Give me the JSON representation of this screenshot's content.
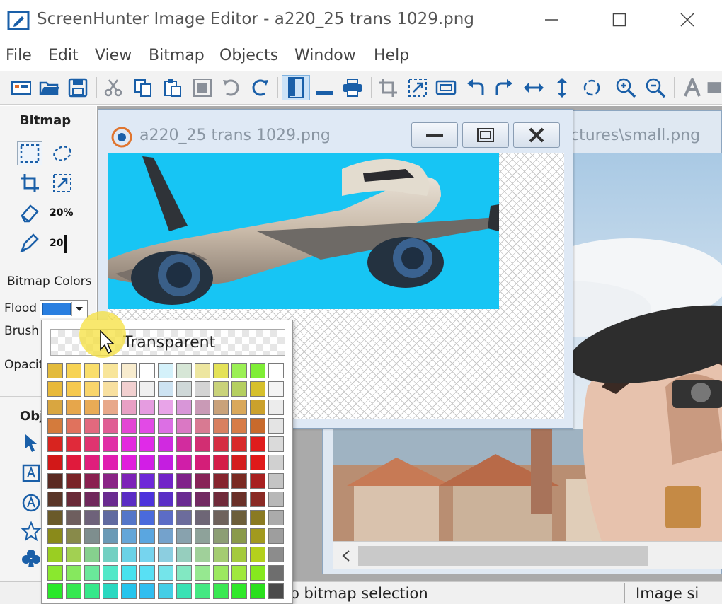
{
  "app": {
    "title": "ScreenHunter Image Editor - a220_25 trans 1029.png"
  },
  "menu": [
    "File",
    "Edit",
    "View",
    "Bitmap",
    "Objects",
    "Window",
    "Help"
  ],
  "left_panel": {
    "bitmap_heading": "Bitmap",
    "zoom_value": "20%",
    "brush_size_value": "20",
    "bitmap_colors_label": "Bitmap Colors",
    "flood_label": "Flood",
    "brush_label": "Brush",
    "opacity_label_partial": "Opacit",
    "objects_heading_partial": "Obj"
  },
  "document_window": {
    "title": "a220_25 trans 1029.png"
  },
  "background_window": {
    "title_partial": "ctures\\small.png"
  },
  "status_bar": {
    "text_partial": "o bitmap selection",
    "right_partial": "Image si"
  },
  "color_dropdown": {
    "transparent_label": "Transparent",
    "flood_color": "#2a7fe0",
    "palette_rows": [
      [
        "#e3bb3c",
        "#f7d354",
        "#f9de6b",
        "#f8e59a",
        "#f8ecce",
        "#ffffff",
        "#d4f1fa",
        "#d6e6d6",
        "#ede6a0",
        "#e4e258",
        "#9bf055",
        "#7fee36",
        "#ffffff"
      ],
      [
        "#e8b93a",
        "#f6c94f",
        "#f9d56b",
        "#f8e0a0",
        "#f2d0d0",
        "#f0f0f0",
        "#cde3f2",
        "#cfd8d8",
        "#d4d4d4",
        "#c9d27a",
        "#b5cf60",
        "#d6c02c",
        "#f4f4f4"
      ],
      [
        "#d9a640",
        "#e6a64b",
        "#e9ab56",
        "#e8a88a",
        "#e8a0c4",
        "#e59ce0",
        "#e8a4e8",
        "#d896d8",
        "#c99ab6",
        "#c9a27a",
        "#d9a85a",
        "#cba12c",
        "#ececec"
      ],
      [
        "#d47b3c",
        "#e0725d",
        "#e2697e",
        "#e05e94",
        "#e346d4",
        "#e24ae6",
        "#dc6fe4",
        "#da78c4",
        "#d87a92",
        "#d88060",
        "#d77c48",
        "#c86a2c",
        "#e4e4e4"
      ],
      [
        "#d8241f",
        "#e02a3a",
        "#e03470",
        "#e12ea6",
        "#e32ade",
        "#e02ae8",
        "#d02ae0",
        "#d22c9e",
        "#d22e72",
        "#d52e42",
        "#d82a2a",
        "#df1c1c",
        "#dadada"
      ],
      [
        "#d21818",
        "#e01a3c",
        "#e01e7c",
        "#e01eb0",
        "#e01edc",
        "#d21ee6",
        "#c41ee0",
        "#d01ea8",
        "#d41e78",
        "#d41e48",
        "#d41e1e",
        "#e01a1a",
        "#d0d0d0"
      ],
      [
        "#5a2a22",
        "#7a2428",
        "#8a2050",
        "#8a2486",
        "#7e22b8",
        "#6e28d8",
        "#7224c8",
        "#80228a",
        "#882458",
        "#86242e",
        "#7a2a22",
        "#a82020",
        "#c4c4c4"
      ],
      [
        "#5a3628",
        "#6a2a38",
        "#70285c",
        "#6a2a90",
        "#5a2cc4",
        "#4c32dc",
        "#5a2ec6",
        "#6a2a92",
        "#722a62",
        "#702a3a",
        "#6a3028",
        "#8a2a24",
        "#b8b8b8"
      ],
      [
        "#6a5a2a",
        "#6e5e5e",
        "#6e627a",
        "#606aa0",
        "#5476c8",
        "#4a6adc",
        "#5c6cc6",
        "#6c6c9c",
        "#6e6676",
        "#6e625c",
        "#6c5e3a",
        "#8a7a22",
        "#ababab"
      ],
      [
        "#8a8a1a",
        "#888a4a",
        "#7e8e8e",
        "#6a9ab6",
        "#64a6d8",
        "#5aa6e0",
        "#74a2cc",
        "#88a2ae",
        "#8ea29a",
        "#8c9e74",
        "#8a9a4a",
        "#a29a1e",
        "#9e9e9e"
      ],
      [
        "#9ace22",
        "#a2d052",
        "#86d08e",
        "#72d0c2",
        "#6ad2e6",
        "#76d4ee",
        "#8ccee0",
        "#96cebe",
        "#a0d09a",
        "#a4cc72",
        "#a4ca3e",
        "#b4d01c",
        "#8c8c8c"
      ],
      [
        "#8ae82e",
        "#86e85e",
        "#6ae89a",
        "#52e8c8",
        "#48e2ee",
        "#58e0f4",
        "#74e4ea",
        "#82e8c2",
        "#96e890",
        "#9ce860",
        "#a0e83e",
        "#86e81e",
        "#6e6e6e"
      ],
      [
        "#2ae82a",
        "#36e850",
        "#36e88a",
        "#2ad8c0",
        "#26c4ec",
        "#30bef0",
        "#44cee6",
        "#3ae2b4",
        "#44e882",
        "#3ae852",
        "#30e82a",
        "#2ae01c",
        "#4a4a4a"
      ]
    ]
  }
}
